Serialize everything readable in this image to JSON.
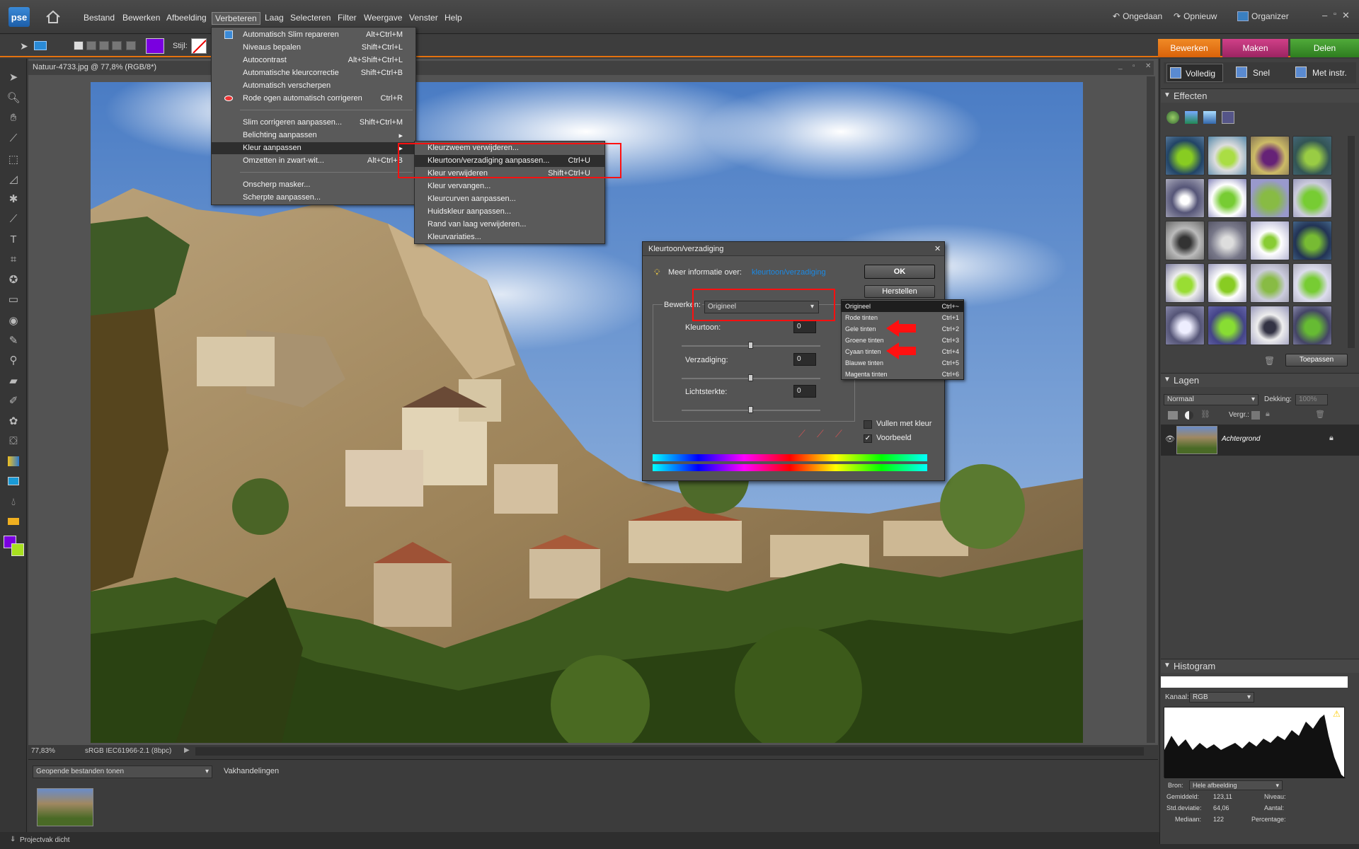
{
  "app": {
    "logo": "pse",
    "home_icon": "home-icon"
  },
  "menu": {
    "items": [
      "Bestand",
      "Bewerken",
      "Afbeelding",
      "Verbeteren",
      "Laag",
      "Selecteren",
      "Filter",
      "Weergave",
      "Venster",
      "Help"
    ]
  },
  "topright": {
    "undo": "Ongedaan",
    "redo": "Opnieuw",
    "organizer": "Organizer"
  },
  "options": {
    "style_label": "Stijl:"
  },
  "modes": {
    "bewerken": "Bewerken",
    "maken": "Maken",
    "delen": "Delen"
  },
  "document": {
    "title": "Natuur-4733.jpg @ 77,8% (RGB/8*)",
    "zoom": "77,83%",
    "profile": "sRGB IEC61966-2.1 (8bpc)"
  },
  "bin": {
    "dropdown": "Geopende bestanden tonen",
    "actions": "Vakhandelingen"
  },
  "footer": {
    "project": "Projectvak dicht"
  },
  "verbeteren_menu": [
    {
      "label": "Automatisch Slim repareren",
      "shortcut": "Alt+Ctrl+M"
    },
    {
      "label": "Niveaus bepalen",
      "shortcut": "Shift+Ctrl+L"
    },
    {
      "label": "Autocontrast",
      "shortcut": "Alt+Shift+Ctrl+L"
    },
    {
      "label": "Automatische kleurcorrectie",
      "shortcut": "Shift+Ctrl+B"
    },
    {
      "label": "Automatisch verscherpen",
      "shortcut": ""
    },
    {
      "label": "Rode ogen automatisch corrigeren",
      "shortcut": "Ctrl+R"
    },
    {
      "label": "Slim corrigeren aanpassen...",
      "shortcut": "Shift+Ctrl+M"
    },
    {
      "label": "Belichting aanpassen",
      "shortcut": ""
    },
    {
      "label": "Kleur aanpassen",
      "shortcut": ""
    },
    {
      "label": "Omzetten in zwart-wit...",
      "shortcut": "Alt+Ctrl+B"
    },
    {
      "label": "Onscherp masker...",
      "shortcut": ""
    },
    {
      "label": "Scherpte aanpassen...",
      "shortcut": ""
    }
  ],
  "kleur_submenu": [
    {
      "label": "Kleurzweem verwijderen...",
      "shortcut": ""
    },
    {
      "label": "Kleurtoon/verzadiging aanpassen...",
      "shortcut": "Ctrl+U"
    },
    {
      "label": "Kleur verwijderen",
      "shortcut": "Shift+Ctrl+U"
    },
    {
      "label": "Kleur vervangen...",
      "shortcut": ""
    },
    {
      "label": "Kleurcurven aanpassen...",
      "shortcut": ""
    },
    {
      "label": "Huidskleur aanpassen...",
      "shortcut": ""
    },
    {
      "label": "Rand van laag verwijderen...",
      "shortcut": ""
    },
    {
      "label": "Kleurvariaties...",
      "shortcut": ""
    }
  ],
  "dialog": {
    "title": "Kleurtoon/verzadiging",
    "info_label": "Meer informatie over:",
    "info_link": "kleurtoon/verzadiging",
    "ok": "OK",
    "reset": "Herstellen",
    "edit_label": "Bewerken:",
    "edit_value": "Origineel",
    "hue_label": "Kleurtoon:",
    "hue_value": "0",
    "sat_label": "Verzadiging:",
    "sat_value": "0",
    "light_label": "Lichtsterkte:",
    "light_value": "0",
    "colorize": "Vullen met kleur",
    "preview": "Voorbeeld"
  },
  "edit_dropdown": [
    {
      "label": "Origineel",
      "shortcut": "Ctrl+~"
    },
    {
      "label": "Rode tinten",
      "shortcut": "Ctrl+1"
    },
    {
      "label": "Gele tinten",
      "shortcut": "Ctrl+2"
    },
    {
      "label": "Groene tinten",
      "shortcut": "Ctrl+3"
    },
    {
      "label": "Cyaan tinten",
      "shortcut": "Ctrl+4"
    },
    {
      "label": "Blauwe tinten",
      "shortcut": "Ctrl+5"
    },
    {
      "label": "Magenta tinten",
      "shortcut": "Ctrl+6"
    }
  ],
  "panel": {
    "tabs": [
      "Volledig",
      "Snel",
      "Met instr."
    ],
    "effects": "Effecten",
    "apply": "Toepassen",
    "layers": "Lagen",
    "blend": "Normaal",
    "opacity_label": "Dekking:",
    "opacity": "100%",
    "lock_label": "Vergr.:",
    "layer_name": "Achtergrond",
    "histogram": "Histogram",
    "channel_label": "Kanaal:",
    "channel": "RGB",
    "source_label": "Bron:",
    "source": "Hele afbeelding",
    "stats": {
      "mean_label": "Gemiddeld:",
      "mean": "123,11",
      "std_label": "Std.deviatie:",
      "std": "64,06",
      "median_label": "Mediaan:",
      "median": "122",
      "level": "Niveau:",
      "count": "Aantal:",
      "percent": "Percentage:"
    }
  },
  "colors": {
    "accent_orange": "#e5720e",
    "maken_pink": "#c2357a",
    "delen_green": "#3f9a2c",
    "foreground": "#7a00e0",
    "link": "#1a8ae6"
  }
}
